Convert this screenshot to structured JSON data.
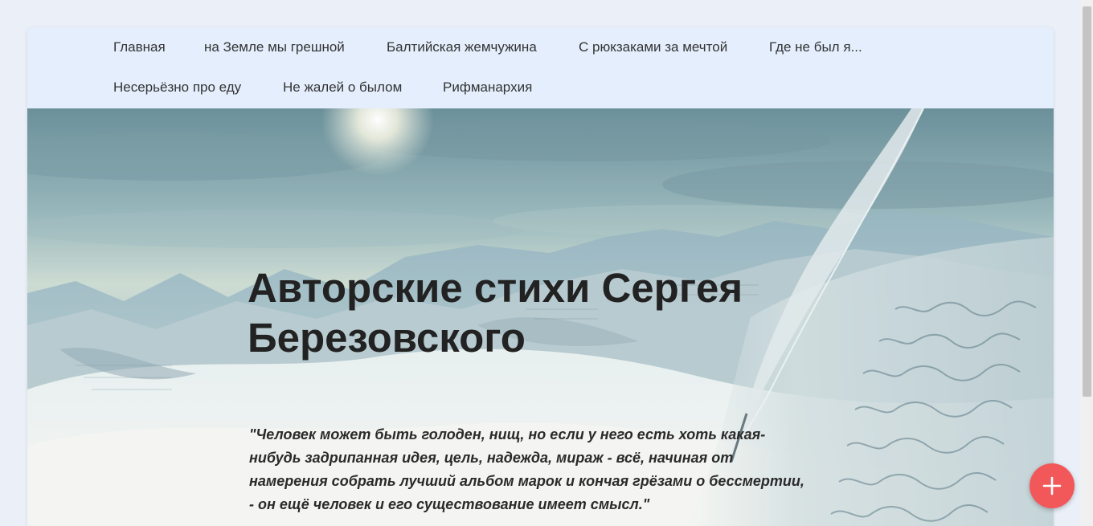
{
  "nav": {
    "items": [
      {
        "label": "Главная"
      },
      {
        "label": "на Земле мы грешной"
      },
      {
        "label": "Балтийская жемчужина"
      },
      {
        "label": "С рюкзаками за мечтой"
      },
      {
        "label": "Где не был я..."
      },
      {
        "label": "Несерьёзно про еду"
      },
      {
        "label": "Не жалей о былом"
      },
      {
        "label": "Рифманархия"
      }
    ]
  },
  "hero": {
    "title": "Авторские стихи Сергея Березовского",
    "quote": "\"Человек может быть голоден, нищ, но если у него есть хоть какая-нибудь задрипанная идея, цель, надежда, мираж - всё, начиная от намерения собрать лучший альбом марок и кончая грёзами о бессмертии, - он ещё человек и его существование имеет смысл.\""
  },
  "fab": {
    "icon": "plus-icon",
    "color": "#f2585a"
  },
  "colors": {
    "nav_background": "#e4eefc",
    "page_background": "#eaeff8",
    "text": "#222222"
  }
}
